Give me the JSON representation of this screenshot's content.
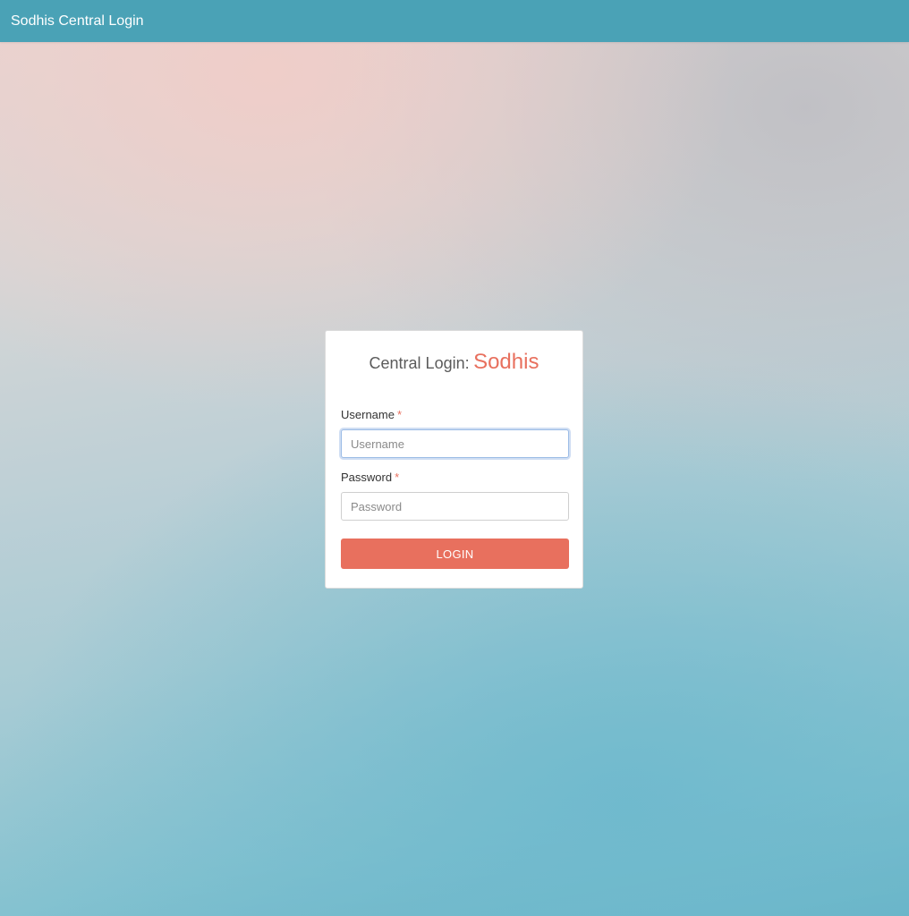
{
  "header": {
    "title": "Sodhis Central Login"
  },
  "login_card": {
    "heading_prefix": "Central Login:",
    "heading_brand": "Sodhis",
    "username": {
      "label": "Username",
      "required_marker": "*",
      "placeholder": "Username",
      "value": ""
    },
    "password": {
      "label": "Password",
      "required_marker": "*",
      "placeholder": "Password",
      "value": ""
    },
    "login_button_label": "LOGIN"
  },
  "colors": {
    "header_bg": "#4aa2b6",
    "accent": "#e8705e",
    "card_bg": "#ffffff"
  }
}
